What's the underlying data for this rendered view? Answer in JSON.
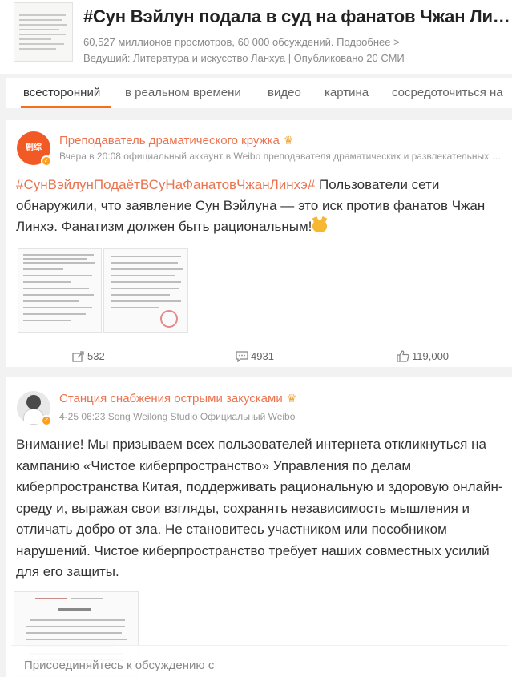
{
  "topic": {
    "title": "#Сун Вэйлун подала в суд на фанатов Чжан Линхэ#",
    "meta": "60,527 миллионов просмотров, 60 000 обсуждений. Подробнее >",
    "host": "Ведущий: Литература и искусство Ланхуа | Опубликовано 20 СМИ"
  },
  "tabs": [
    {
      "label": "всесторонний",
      "active": true
    },
    {
      "label": "в реальном времени"
    },
    {
      "label": "видео"
    },
    {
      "label": "картина"
    },
    {
      "label": "сосредоточиться на"
    }
  ],
  "posts": [
    {
      "avatar_text": "剧综",
      "author": "Преподаватель драматического кружка",
      "subline": "Вчера в 20:08 официальный аккаунт в Weibo преподавателя драматических и развлекательных программ",
      "hashtag": "#СунВэйлунПодаётВСуНаФанатовЧжанЛинхэ#",
      "text": " Пользователи сети обнаружили, что заявление Сун Вэйлуна — это иск против фанатов Чжан Линхэ. Фанатизм должен быть рациональным!",
      "reposts": "532",
      "comments": "4931",
      "likes": "119,000"
    },
    {
      "author": "Станция снабжения острыми закусками",
      "subline": "4-25 06:23 Song Weilong Studio Официальный Weibo",
      "text": "Внимание! Мы призываем всех пользователей интернета откликнуться на кампанию «Чистое киберпространство» Управления по делам киберпространства Китая, поддерживать рациональную и здоровую онлайн-среду и, выражая свои взгляды, сохранять независимость мышления и отличать добро от зла. Не становитесь участником или пособником нарушений. Чистое киберпространство требует наших совместных усилий для его защиты."
    }
  ],
  "compose": {
    "placeholder": "Присоединяйтесь к обсуждению с"
  },
  "colors": {
    "accent": "#f66f19",
    "author": "#eb7350",
    "verified": "#ff9f1c"
  }
}
